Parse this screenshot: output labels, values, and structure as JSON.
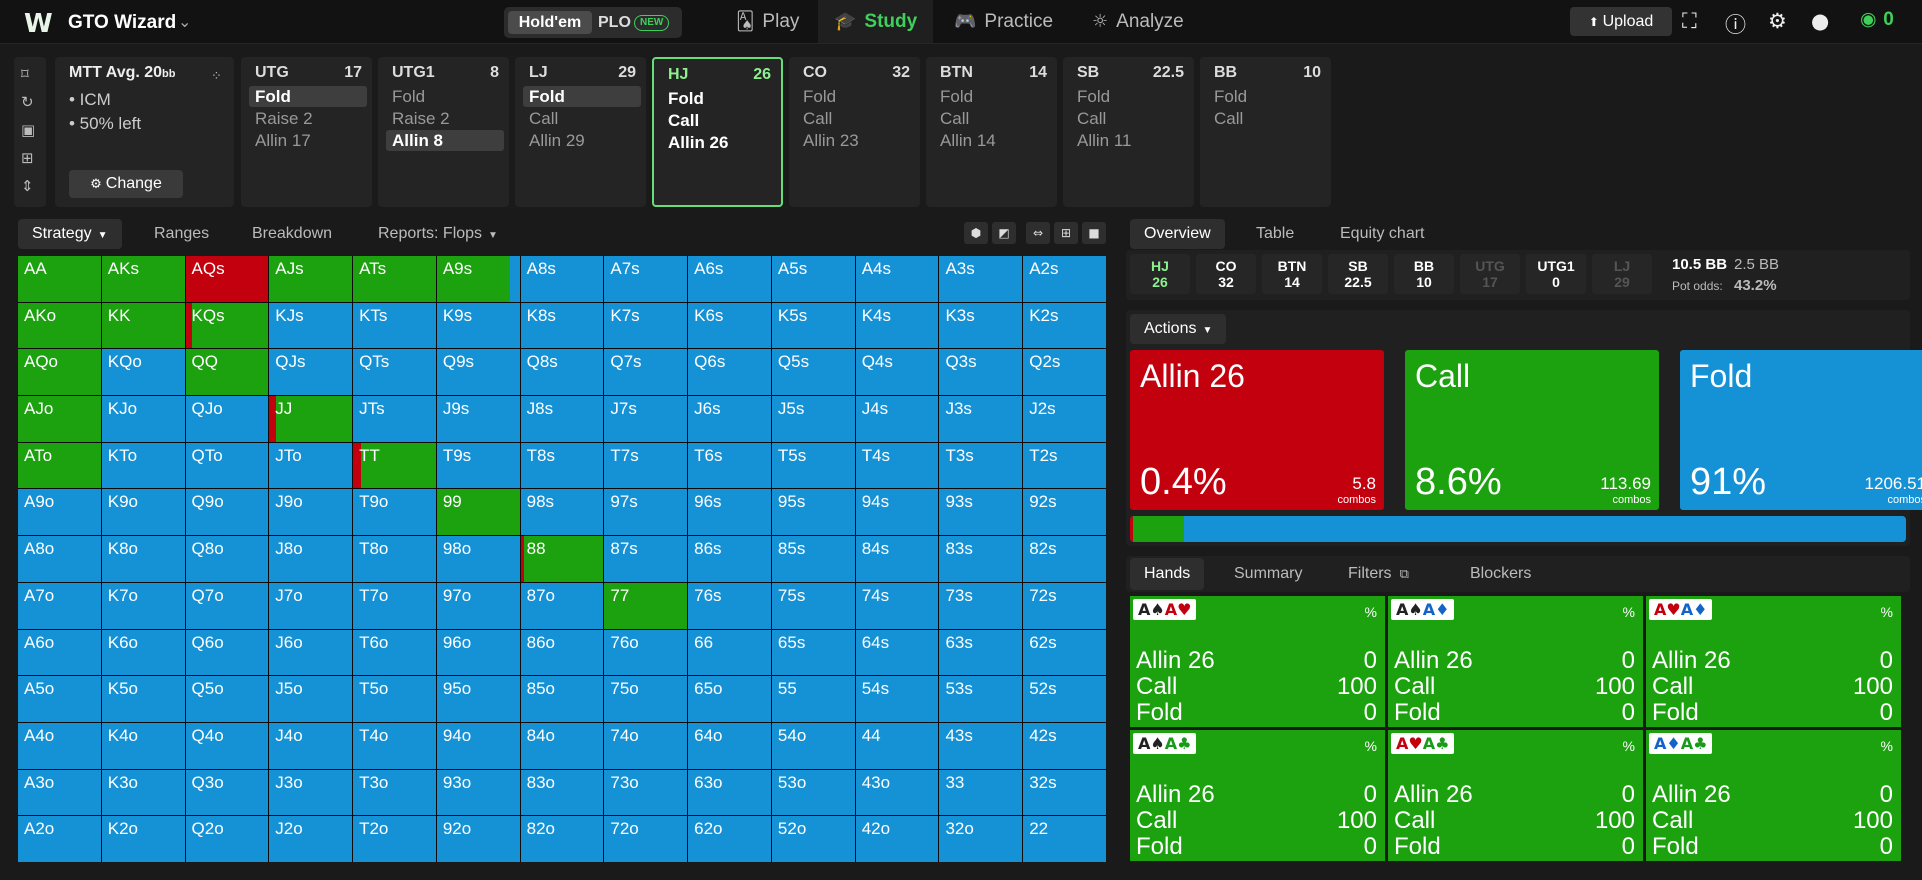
{
  "topbar": {
    "logo": "W",
    "brand": "GTO Wizard",
    "brand_chevron": "⌄",
    "game": {
      "holdem": "Hold'em",
      "plo": "PLO",
      "badge": "NEW"
    },
    "nav": {
      "play": "Play",
      "study": "Study",
      "practice": "Practice",
      "analyze": "Analyze"
    },
    "upload": "Upload",
    "coins": "0"
  },
  "tools": [
    "bookmark-icon",
    "history-icon",
    "save-icon",
    "gamepad-icon",
    "expand-icon"
  ],
  "spot": {
    "title": "MTT  Avg. 20",
    "title_unit": "bb",
    "lines": [
      "• ICM",
      "• 50% left"
    ],
    "change": "Change"
  },
  "positions": [
    {
      "name": "UTG",
      "stack": "17",
      "opts": [
        "Fold",
        "Raise 2",
        "Allin 17"
      ],
      "hl": 0
    },
    {
      "name": "UTG1",
      "stack": "8",
      "opts": [
        "Fold",
        "Raise 2",
        "Allin 8"
      ],
      "hl": 2
    },
    {
      "name": "LJ",
      "stack": "29",
      "opts": [
        "Fold",
        "Call",
        "Allin 29"
      ],
      "hl": 0
    },
    {
      "name": "HJ",
      "stack": "26",
      "opts": [
        "Fold",
        "Call",
        "Allin 26"
      ],
      "hl": -1,
      "sel": true
    },
    {
      "name": "CO",
      "stack": "32",
      "opts": [
        "Fold",
        "Call",
        "Allin 23"
      ],
      "hl": -1
    },
    {
      "name": "BTN",
      "stack": "14",
      "opts": [
        "Fold",
        "Call",
        "Allin 14"
      ],
      "hl": -1
    },
    {
      "name": "SB",
      "stack": "22.5",
      "opts": [
        "Fold",
        "Call",
        "Allin 11"
      ],
      "hl": -1
    },
    {
      "name": "BB",
      "stack": "10",
      "opts": [
        "Fold",
        "Call"
      ],
      "hl": -1
    }
  ],
  "left_tabs": {
    "strategy": "Strategy",
    "ranges": "Ranges",
    "breakdown": "Breakdown",
    "reports": "Reports: Flops"
  },
  "colors": {
    "allin": "#c3000d",
    "call": "#1ca10f",
    "fold": "#1591d6"
  },
  "matrix": [
    [
      "AA",
      "AKs",
      "AQs",
      "AJs",
      "ATs",
      "A9s",
      "A8s",
      "A7s",
      "A6s",
      "A5s",
      "A4s",
      "A3s",
      "A2s"
    ],
    [
      "AKo",
      "KK",
      "KQs",
      "KJs",
      "KTs",
      "K9s",
      "K8s",
      "K7s",
      "K6s",
      "K5s",
      "K4s",
      "K3s",
      "K2s"
    ],
    [
      "AQo",
      "KQo",
      "QQ",
      "QJs",
      "QTs",
      "Q9s",
      "Q8s",
      "Q7s",
      "Q6s",
      "Q5s",
      "Q4s",
      "Q3s",
      "Q2s"
    ],
    [
      "AJo",
      "KJo",
      "QJo",
      "JJ",
      "JTs",
      "J9s",
      "J8s",
      "J7s",
      "J6s",
      "J5s",
      "J4s",
      "J3s",
      "J2s"
    ],
    [
      "ATo",
      "KTo",
      "QTo",
      "JTo",
      "TT",
      "T9s",
      "T8s",
      "T7s",
      "T6s",
      "T5s",
      "T4s",
      "T3s",
      "T2s"
    ],
    [
      "A9o",
      "K9o",
      "Q9o",
      "J9o",
      "T9o",
      "99",
      "98s",
      "97s",
      "96s",
      "95s",
      "94s",
      "93s",
      "92s"
    ],
    [
      "A8o",
      "K8o",
      "Q8o",
      "J8o",
      "T8o",
      "98o",
      "88",
      "87s",
      "86s",
      "85s",
      "84s",
      "83s",
      "82s"
    ],
    [
      "A7o",
      "K7o",
      "Q7o",
      "J7o",
      "T7o",
      "97o",
      "87o",
      "77",
      "76s",
      "75s",
      "74s",
      "73s",
      "72s"
    ],
    [
      "A6o",
      "K6o",
      "Q6o",
      "J6o",
      "T6o",
      "96o",
      "86o",
      "76o",
      "66",
      "65s",
      "64s",
      "63s",
      "62s"
    ],
    [
      "A5o",
      "K5o",
      "Q5o",
      "J5o",
      "T5o",
      "95o",
      "85o",
      "75o",
      "65o",
      "55",
      "54s",
      "53s",
      "52s"
    ],
    [
      "A4o",
      "K4o",
      "Q4o",
      "J4o",
      "T4o",
      "94o",
      "84o",
      "74o",
      "64o",
      "54o",
      "44",
      "43s",
      "42s"
    ],
    [
      "A3o",
      "K3o",
      "Q3o",
      "J3o",
      "T3o",
      "93o",
      "83o",
      "73o",
      "63o",
      "53o",
      "43o",
      "33",
      "32s"
    ],
    [
      "A2o",
      "K2o",
      "Q2o",
      "J2o",
      "T2o",
      "92o",
      "82o",
      "72o",
      "62o",
      "52o",
      "42o",
      "32o",
      "22"
    ]
  ],
  "strategy": {
    "AA": [
      0,
      100
    ],
    "AKs": [
      0,
      100
    ],
    "AQs": [
      100,
      0
    ],
    "AJs": [
      0,
      100
    ],
    "ATs": [
      0,
      100
    ],
    "A9s": [
      0,
      88
    ],
    "AKo": [
      0,
      100
    ],
    "KK": [
      0,
      100
    ],
    "KQs": [
      8,
      92
    ],
    "AQo": [
      0,
      100
    ],
    "QQ": [
      0,
      100
    ],
    "AJo": [
      0,
      100
    ],
    "JJ": [
      8,
      92
    ],
    "ATo": [
      0,
      100
    ],
    "TT": [
      10,
      90
    ],
    "99": [
      0,
      100
    ],
    "88": [
      4,
      96
    ],
    "77": [
      0,
      100
    ]
  },
  "right_tabs": {
    "overview": "Overview",
    "table": "Table",
    "equity": "Equity chart"
  },
  "ov_positions": [
    {
      "n": "HJ",
      "s": "26",
      "cur": true
    },
    {
      "n": "CO",
      "s": "32"
    },
    {
      "n": "BTN",
      "s": "14"
    },
    {
      "n": "SB",
      "s": "22.5"
    },
    {
      "n": "BB",
      "s": "10"
    },
    {
      "n": "UTG",
      "s": "17",
      "dim": true
    },
    {
      "n": "UTG1",
      "s": "0"
    },
    {
      "n": "LJ",
      "s": "29",
      "dim": true
    }
  ],
  "pot": {
    "total": "10.5 BB",
    "bet": "2.5 BB",
    "odds_label": "Pot odds:",
    "odds": "43.2%"
  },
  "actions_label": "Actions",
  "actions": [
    {
      "name": "Allin 26",
      "pct": "0.4%",
      "combos": "5.8",
      "unit": "combos",
      "color": "#c3000d"
    },
    {
      "name": "Call",
      "pct": "8.6%",
      "combos": "113.69",
      "unit": "combos",
      "color": "#1ca10f"
    },
    {
      "name": "Fold",
      "pct": "91%",
      "combos": "1206.51",
      "unit": "combos",
      "color": "#1591d6"
    }
  ],
  "action_bar": {
    "allin": 0.4,
    "call": 6.6,
    "fold": 93
  },
  "bottom_tabs": {
    "hands": "Hands",
    "summary": "Summary",
    "filters": "Filters",
    "blockers": "Blockers"
  },
  "hands": [
    {
      "c1": "A♠",
      "c2": "A♥",
      "pct": "%",
      "rows": [
        [
          "Allin 26",
          "0"
        ],
        [
          "Call",
          "100"
        ],
        [
          "Fold",
          "0"
        ]
      ]
    },
    {
      "c1": "A♠",
      "c2": "A♦",
      "pct": "%",
      "rows": [
        [
          "Allin 26",
          "0"
        ],
        [
          "Call",
          "100"
        ],
        [
          "Fold",
          "0"
        ]
      ]
    },
    {
      "c1": "A♥",
      "c2": "A♦",
      "pct": "%",
      "rows": [
        [
          "Allin 26",
          "0"
        ],
        [
          "Call",
          "100"
        ],
        [
          "Fold",
          "0"
        ]
      ]
    },
    {
      "c1": "A♠",
      "c2": "A♣",
      "pct": "%",
      "rows": [
        [
          "Allin 26",
          "0"
        ],
        [
          "Call",
          "100"
        ],
        [
          "Fold",
          "0"
        ]
      ]
    },
    {
      "c1": "A♥",
      "c2": "A♣",
      "pct": "%",
      "rows": [
        [
          "Allin 26",
          "0"
        ],
        [
          "Call",
          "100"
        ],
        [
          "Fold",
          "0"
        ]
      ]
    },
    {
      "c1": "A♦",
      "c2": "A♣",
      "pct": "%",
      "rows": [
        [
          "Allin 26",
          "0"
        ],
        [
          "Call",
          "100"
        ],
        [
          "Fold",
          "0"
        ]
      ]
    }
  ]
}
